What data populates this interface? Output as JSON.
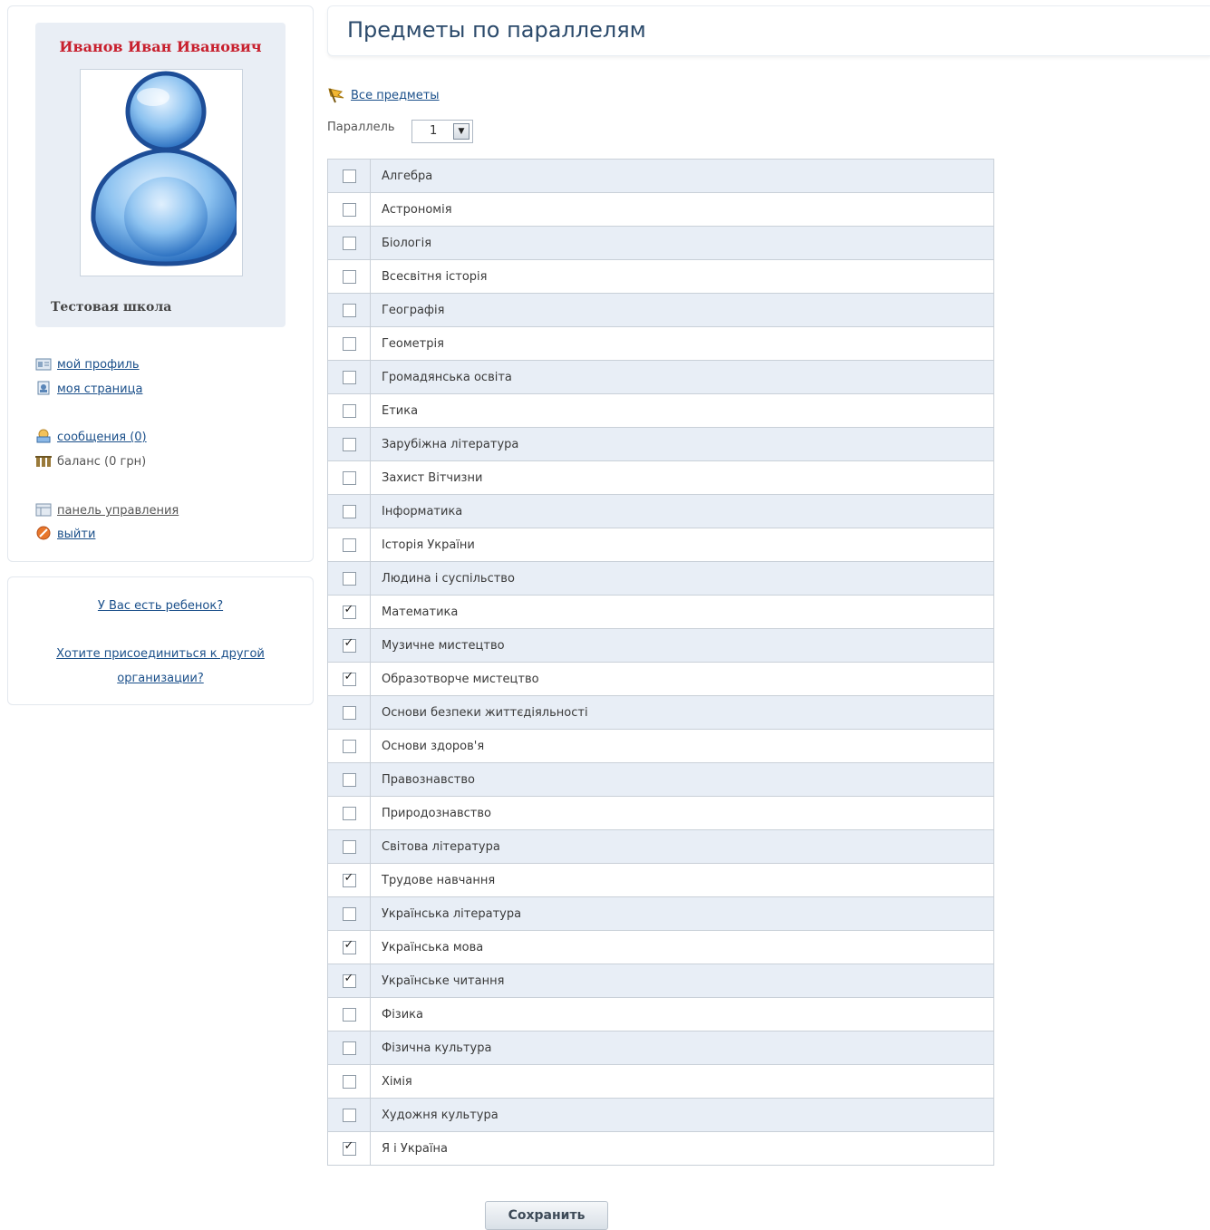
{
  "profile": {
    "name": "Иванов Иван Иванович",
    "school": "Тестовая школа"
  },
  "menu": {
    "my_profile": "мой профиль",
    "my_page": "моя страница",
    "messages": "сообщения (0)",
    "balance": "баланс (0 грн)",
    "control_panel": "панель управления",
    "logout": "выйти"
  },
  "side_links": {
    "child": "У Вас есть ребенок?",
    "join_org_line1": "Хотите присоединиться к другой",
    "join_org_line2": "организации?"
  },
  "page": {
    "title": "Предметы по параллелям",
    "all_subjects": "Все предметы",
    "parallel_label": "Параллель",
    "parallel_value": "1"
  },
  "subjects": [
    {
      "name": "Алгебра",
      "checked": false
    },
    {
      "name": "Астрономія",
      "checked": false
    },
    {
      "name": "Біологія",
      "checked": false
    },
    {
      "name": "Всесвітня історія",
      "checked": false
    },
    {
      "name": "Географія",
      "checked": false
    },
    {
      "name": "Геометрія",
      "checked": false
    },
    {
      "name": "Громадянська освіта",
      "checked": false
    },
    {
      "name": "Етика",
      "checked": false
    },
    {
      "name": "Зарубіжна література",
      "checked": false
    },
    {
      "name": "Захист Вітчизни",
      "checked": false
    },
    {
      "name": "Інформатика",
      "checked": false
    },
    {
      "name": "Історія України",
      "checked": false
    },
    {
      "name": "Людина і суспільство",
      "checked": false
    },
    {
      "name": "Математика",
      "checked": true
    },
    {
      "name": "Музичне мистецтво",
      "checked": true
    },
    {
      "name": "Образотворче мистецтво",
      "checked": true
    },
    {
      "name": "Основи безпеки життєдіяльності",
      "checked": false
    },
    {
      "name": "Основи здоров'я",
      "checked": false
    },
    {
      "name": "Правознавство",
      "checked": false
    },
    {
      "name": "Природознавство",
      "checked": false
    },
    {
      "name": "Світова література",
      "checked": false
    },
    {
      "name": "Трудове навчання",
      "checked": true
    },
    {
      "name": "Українська література",
      "checked": false
    },
    {
      "name": "Українська мова",
      "checked": true
    },
    {
      "name": "Українське читання",
      "checked": true
    },
    {
      "name": "Фізика",
      "checked": false
    },
    {
      "name": "Фізична культура",
      "checked": false
    },
    {
      "name": "Хімія",
      "checked": false
    },
    {
      "name": "Художня культура",
      "checked": false
    },
    {
      "name": "Я і Україна",
      "checked": true
    }
  ],
  "actions": {
    "save": "Сохранить"
  },
  "colors": {
    "name_red": "#c8202e",
    "link_blue": "#1a4f8a",
    "row_stripe": "#e8eef6"
  }
}
